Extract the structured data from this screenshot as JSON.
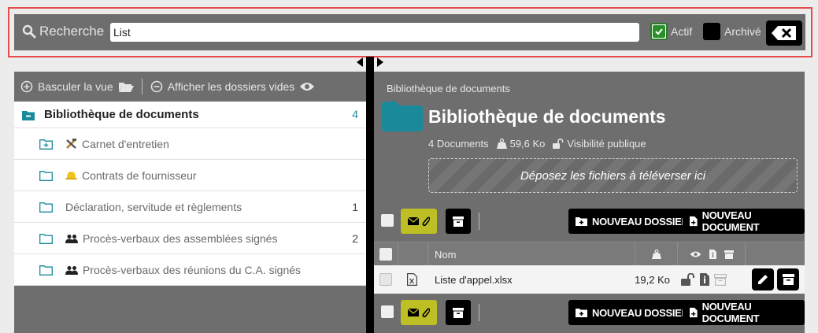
{
  "search": {
    "label": "Recherche",
    "value": "List",
    "actif_label": "Actif",
    "archive_label": "Archivé"
  },
  "left": {
    "toggle_view": "Basculer la vue",
    "show_empty": "Afficher les dossiers vides",
    "root": {
      "label": "Bibliothèque de documents",
      "count": "4"
    },
    "items": [
      {
        "label": "Carnet d'entretien",
        "count": "",
        "icon": "tools-icon"
      },
      {
        "label": "Contrats de fournisseur",
        "count": "",
        "icon": "hardhat-icon"
      },
      {
        "label": "Déclaration, servitude et règlements",
        "count": "1",
        "icon": ""
      },
      {
        "label": "Procès-verbaux des assemblées signés",
        "count": "2",
        "icon": "users-icon"
      },
      {
        "label": "Procès-verbaux des réunions du C.A. signés",
        "count": "",
        "icon": "users-icon"
      }
    ]
  },
  "right": {
    "breadcrumb": "Bibliothèque de documents",
    "title": "Bibliothèque de documents",
    "doc_count": "4 Documents",
    "size": "59,6 Ko",
    "visibility": "Visibilité publique",
    "dropzone": "Déposez les fichiers à téléverser ici",
    "new_folder": "NOUVEAU DOSSIER",
    "new_document": "NOUVEAU DOCUMENT",
    "col_name": "Nom",
    "rows": [
      {
        "name": "Liste d'appel.xlsx",
        "size": "19,2 Ko"
      }
    ]
  },
  "colors": {
    "accent_teal": "#1a8a9a",
    "olive": "#bdbf24",
    "panel": "#6e6e6e",
    "highlight_red": "#e74c4c"
  }
}
